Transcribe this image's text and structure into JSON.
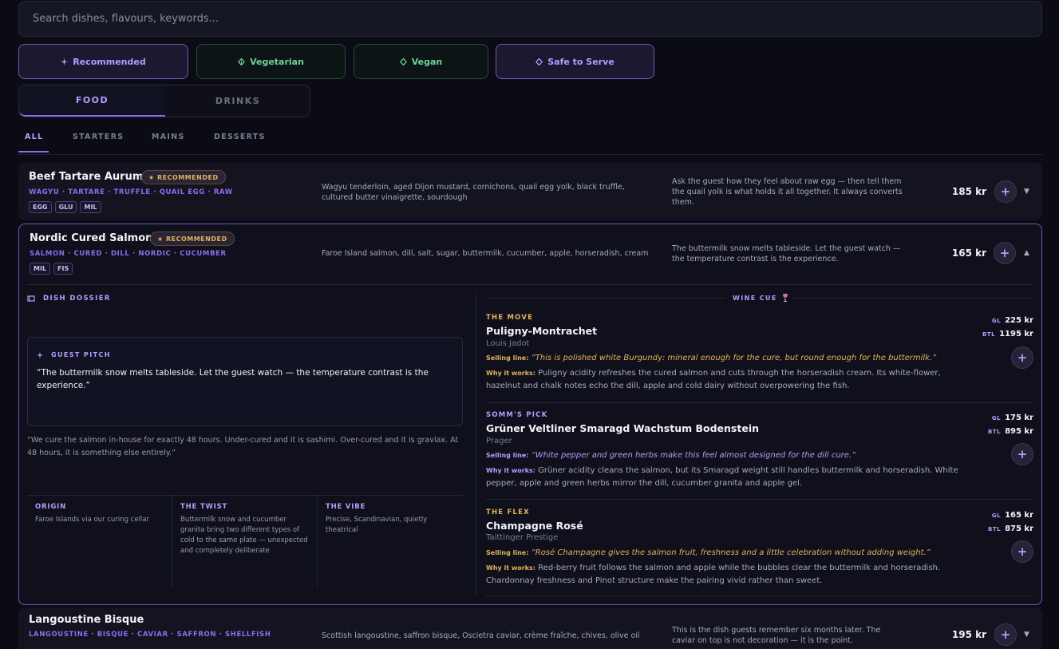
{
  "search": {
    "placeholder": "Search dishes, flavours, keywords..."
  },
  "filters": [
    {
      "label": "Recommended",
      "icon": "sparkle-icon"
    },
    {
      "label": "Vegetarian",
      "icon": "leaf-icon"
    },
    {
      "label": "Vegan",
      "icon": "leaf-icon"
    },
    {
      "label": "Safe to Serve",
      "icon": "diamond-icon"
    }
  ],
  "mode_toggle": {
    "food": "FOOD",
    "drinks": "DRINKS",
    "active": "food"
  },
  "category_tabs": [
    "ALL",
    "STARTERS",
    "MAINS",
    "DESSERTS"
  ],
  "dishes": [
    {
      "name": "Beef Tartare Aurum",
      "badge": "★ RECOMMENDED",
      "tags": "WAGYU · TARTARE · TRUFFLE · QUAIL EGG · RAW",
      "allergens": [
        "EGG",
        "GLU",
        "MIL"
      ],
      "ingredients": "Wagyu tenderloin, aged Dijon mustard, cornichons, quail egg yolk, black truffle, cultured butter vinaigrette, sourdough",
      "pitch": "Ask the guest how they feel about raw egg — then tell them the quail yolk is what holds it all together. It always converts them.",
      "price": "185 kr",
      "chevron": "▼"
    },
    {
      "name": "Nordic Cured Salmon",
      "badge": "★ RECOMMENDED",
      "tags": "SALMON · CURED · DILL · NORDIC · CUCUMBER",
      "allergens": [
        "MIL",
        "FIS"
      ],
      "ingredients": "Faroe Island salmon, dill, salt, sugar, buttermilk, cucumber, apple, horseradish, cream",
      "pitch": "The buttermilk snow melts tableside. Let the guest watch — the temperature contrast is the experience.",
      "price": "165 kr",
      "chevron": "▲"
    },
    {
      "name": "Langoustine Bisque",
      "tags": "LANGOUSTINE · BISQUE · CAVIAR · SAFFRON · SHELLFISH",
      "ingredients": "Scottish langoustine, saffron bisque, Oscietra caviar, crème fraîche, chives, olive oil",
      "pitch": "This is the dish guests remember six months later. The caviar on top is not decoration — it is the point.",
      "price": "195 kr",
      "chevron": "▼"
    }
  ],
  "dossier": {
    "title": "DISH DOSSIER",
    "guest_pitch_label": "GUEST PITCH",
    "guest_pitch": "“The buttermilk snow melts tableside. Let the guest watch — the temperature contrast is the experience.”",
    "chef_note": "“We cure the salmon in-house for exactly 48 hours. Under-cured and it is sashimi. Over-cured and it is gravlax. At 48 hours, it is something else entirely.”",
    "info": [
      {
        "title": "ORIGIN",
        "text": "Faroe Islands via our curing cellar"
      },
      {
        "title": "THE TWIST",
        "text": "Buttermilk snow and cucumber granita bring two different types of cold to the same plate — unexpected and completely deliberate"
      },
      {
        "title": "THE VIBE",
        "text": "Precise, Scandinavian, quietly theatrical"
      }
    ]
  },
  "wine_cue": {
    "title": "WINE CUE",
    "selling_label": "Selling line:",
    "why_label": "Why it works:",
    "gl_label": "GL",
    "btl_label": "BTL",
    "wines": [
      {
        "label": "THE MOVE",
        "name": "Puligny-Montrachet",
        "producer": "Louis Jadot",
        "selling": "“This is polished white Burgundy: mineral enough for the cure, but round enough for the buttermilk.”",
        "why": "Puligny acidity refreshes the cured salmon and cuts through the horseradish cream. Its white-flower, hazelnut and chalk notes echo the dill, apple and cold dairy without overpowering the fish.",
        "glass": "225 kr",
        "bottle": "1195 kr"
      },
      {
        "label": "SOMM'S PICK",
        "name": "Grüner Veltliner Smaragd Wachstum Bodenstein",
        "producer": "Prager",
        "selling": "“White pepper and green herbs make this feel almost designed for the dill cure.”",
        "why": "Grüner acidity cleans the salmon, but its Smaragd weight still handles buttermilk and horseradish. White pepper, apple and green herbs mirror the dill, cucumber granita and apple gel.",
        "glass": "175 kr",
        "bottle": "895 kr"
      },
      {
        "label": "THE FLEX",
        "name": "Champagne Rosé",
        "producer": "Taittinger Prestige",
        "selling": "“Rosé Champagne gives the salmon fruit, freshness and a little celebration without adding weight.”",
        "why": "Red-berry fruit follows the salmon and apple while the bubbles clear the buttermilk and horseradish. Chardonnay freshness and Pinot structure make the pairing vivid rather than sweet.",
        "glass": "165 kr",
        "bottle": "875 kr"
      }
    ]
  },
  "colors": {
    "background": "#0a0b14",
    "accent": "#8d6cf0",
    "accent_light": "#b79cff",
    "gold": "#e0b35c",
    "green": "#6fd39a"
  }
}
